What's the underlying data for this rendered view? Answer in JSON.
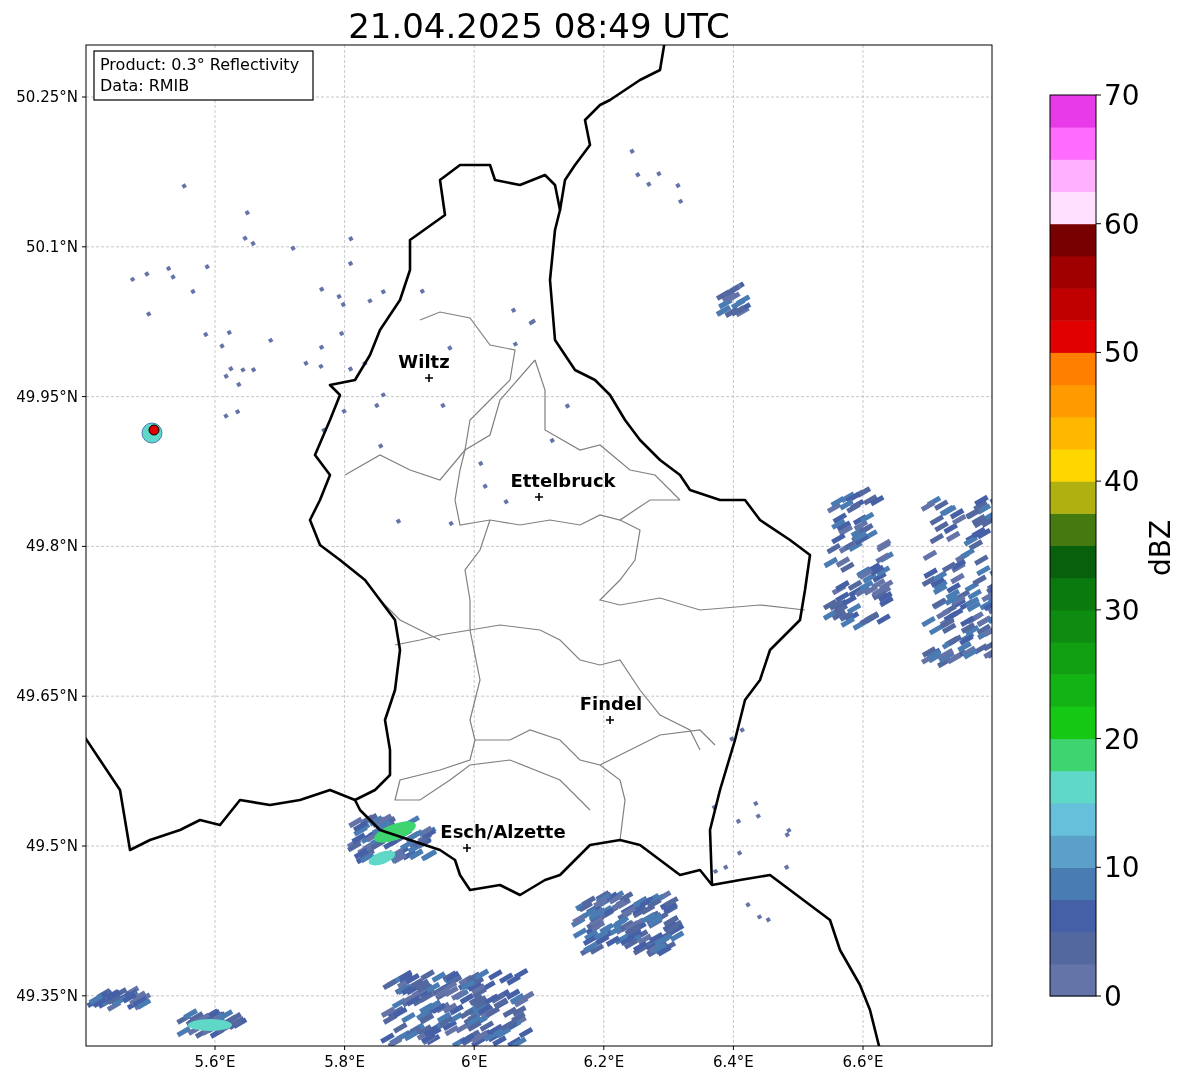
{
  "title": "21.04.2025 08:49 UTC",
  "info_box": {
    "lines": [
      "Product: 0.3° Reflectivity",
      "Data: RMIB"
    ]
  },
  "map": {
    "yticks": [
      "50.25°N",
      "50.1°N",
      "49.95°N",
      "49.8°N",
      "49.65°N",
      "49.5°N",
      "49.35°N"
    ],
    "xticks": [
      "5.6°E",
      "5.8°E",
      "6°E",
      "6.2°E",
      "6.4°E",
      "6.6°E"
    ],
    "cities": [
      {
        "name": "Wiltz"
      },
      {
        "name": "Ettelbruck"
      },
      {
        "name": "Findel"
      },
      {
        "name": "Esch/Alzette"
      }
    ]
  },
  "colorbar": {
    "label": "dBZ",
    "ticks": [
      "70",
      "60",
      "50",
      "40",
      "30",
      "20",
      "10",
      "0"
    ],
    "bins": [
      {
        "color": "#6474a8"
      },
      {
        "color": "#5468a0"
      },
      {
        "color": "#4560a6"
      },
      {
        "color": "#4a7cb4"
      },
      {
        "color": "#5aa0c8"
      },
      {
        "color": "#66c0dc"
      },
      {
        "color": "#60d8c8"
      },
      {
        "color": "#3ed470"
      },
      {
        "color": "#14c814"
      },
      {
        "color": "#12b414"
      },
      {
        "color": "#10a012"
      },
      {
        "color": "#0e8c12"
      },
      {
        "color": "#0a7a0e"
      },
      {
        "color": "#08600c"
      },
      {
        "color": "#447a10"
      },
      {
        "color": "#b0b010"
      },
      {
        "color": "#ffd700"
      },
      {
        "color": "#ffb700"
      },
      {
        "color": "#ff9a00"
      },
      {
        "color": "#ff7f00"
      },
      {
        "color": "#e00000"
      },
      {
        "color": "#c00000"
      },
      {
        "color": "#a00000"
      },
      {
        "color": "#780000"
      },
      {
        "color": "#ffe0ff"
      },
      {
        "color": "#ffb0ff"
      },
      {
        "color": "#ff6cff"
      },
      {
        "color": "#e83ae8"
      }
    ]
  }
}
